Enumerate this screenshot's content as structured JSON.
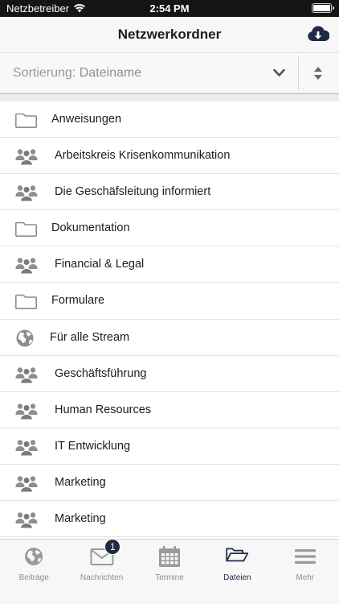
{
  "status_bar": {
    "carrier": "Netzbetreiber",
    "time": "2:54 PM",
    "wifi_icon": "wifi-icon",
    "battery_icon": "battery-icon"
  },
  "nav": {
    "title": "Netzwerkordner",
    "download_icon": "cloud-download-icon"
  },
  "sort": {
    "label": "Sortierung:",
    "value": "Dateiname",
    "dropdown_icon": "chevron-down-icon",
    "order_icon": "sort-order-icon"
  },
  "items": [
    {
      "label": "Anweisungen",
      "icon": "folder-icon"
    },
    {
      "label": "Arbeitskreis Krisenkommunikation",
      "icon": "users-icon"
    },
    {
      "label": "Die Geschäfsleitung informiert",
      "icon": "users-icon"
    },
    {
      "label": "Dokumentation",
      "icon": "folder-icon"
    },
    {
      "label": "Financial & Legal",
      "icon": "users-icon"
    },
    {
      "label": "Formulare",
      "icon": "folder-icon"
    },
    {
      "label": "Für alle Stream",
      "icon": "globe-icon"
    },
    {
      "label": "Geschäftsführung",
      "icon": "users-icon"
    },
    {
      "label": "Human Resources",
      "icon": "users-icon"
    },
    {
      "label": "IT Entwicklung",
      "icon": "users-icon"
    },
    {
      "label": "Marketing",
      "icon": "users-icon"
    },
    {
      "label": "Marketing",
      "icon": "users-icon"
    }
  ],
  "tabs": [
    {
      "label": "Beiträge",
      "icon": "globe-icon",
      "active": false
    },
    {
      "label": "Nachrichten",
      "icon": "envelope-icon",
      "active": false,
      "badge": "1"
    },
    {
      "label": "Termine",
      "icon": "calendar-icon",
      "active": false
    },
    {
      "label": "Dateien",
      "icon": "folder-open-icon",
      "active": true
    },
    {
      "label": "Mehr",
      "icon": "menu-icon",
      "active": false
    }
  ],
  "colors": {
    "accent": "#1f2a44",
    "icon_gray": "#8e8e8e",
    "tab_inactive": "#8e8e93"
  }
}
